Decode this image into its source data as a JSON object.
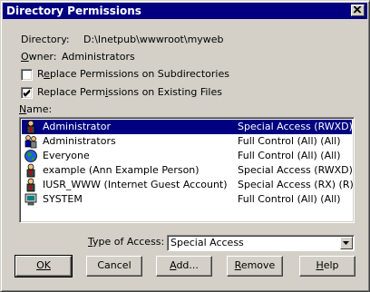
{
  "window": {
    "title": "Directory Permissions",
    "close_icon": "close-icon"
  },
  "directory": {
    "label": "Directory:",
    "value": "D:\\Inetpub\\wwwroot\\myweb"
  },
  "owner": {
    "label_prefix": "Owner:",
    "value": "Administrators"
  },
  "options": {
    "replace_subdirs": {
      "label": "Replace Permissions on Subdirectories",
      "accel": "e",
      "checked": false
    },
    "replace_files": {
      "label": "Replace Permissions on Existing Files",
      "accel": "i",
      "checked": true
    }
  },
  "names_label": "Name:",
  "names": [
    {
      "name": "Administrator",
      "access": "Special Access (RWXD) (R",
      "icon": "user-icon",
      "selected": true
    },
    {
      "name": "Administrators",
      "access": "Full Control (All) (All)",
      "icon": "group-icon",
      "selected": false
    },
    {
      "name": "Everyone",
      "access": "Full Control (All) (All)",
      "icon": "globe-icon",
      "selected": false
    },
    {
      "name": "example (Ann Example Person)",
      "access": "Special Access (RWXD) (R",
      "icon": "user-icon",
      "selected": false
    },
    {
      "name": "IUSR_WWW (Internet Guest Account)",
      "access": "Special Access (RX) (R)",
      "icon": "user-icon",
      "selected": false
    },
    {
      "name": "SYSTEM",
      "access": "Full Control (All) (All)",
      "icon": "system-icon",
      "selected": false
    }
  ],
  "type_of_access": {
    "label": "Type of Access:",
    "value": "Special Access"
  },
  "buttons": {
    "ok": "OK",
    "cancel": "Cancel",
    "add": "Add...",
    "remove": "Remove",
    "help": "Help"
  },
  "colors": {
    "titlebar": "#000080",
    "face": "#d4d0c8",
    "selection": "#000080"
  }
}
